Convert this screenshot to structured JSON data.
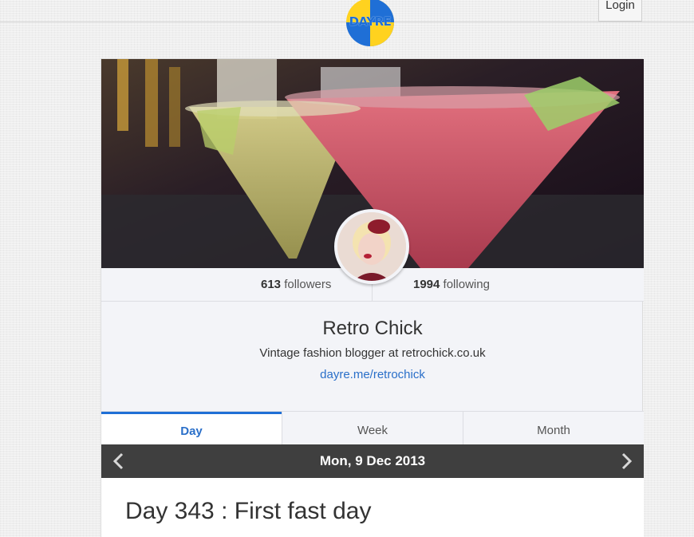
{
  "header": {
    "logo_text": "DAYRE",
    "login_label": "Login"
  },
  "colors": {
    "accent": "#1f6fd6",
    "logo_yellow": "#ffd21f",
    "datebar_bg": "#3f3f3f",
    "link": "#2a6fc9"
  },
  "profile": {
    "followers_count": "613",
    "followers_label": "followers",
    "following_count": "1994",
    "following_label": "following",
    "name": "Retro Chick",
    "bio": "Vintage fashion blogger at retrochick.co.uk",
    "link": "dayre.me/retrochick"
  },
  "tabs": [
    {
      "label": "Day",
      "active": true
    },
    {
      "label": "Week",
      "active": false
    },
    {
      "label": "Month",
      "active": false
    }
  ],
  "datebar": {
    "date": "Mon, 9 Dec 2013",
    "prev_icon": "chevron-left-icon",
    "next_icon": "chevron-right-icon"
  },
  "post": {
    "title": "Day 343 : First fast day"
  }
}
